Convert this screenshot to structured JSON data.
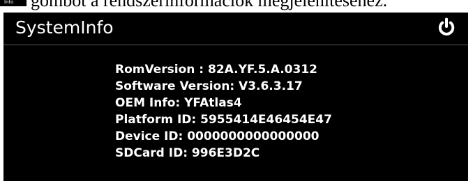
{
  "document_fragment": {
    "icon_label": "Info",
    "text": "gombot a rendszerinformációk megjelenítéséhez."
  },
  "window": {
    "title": "SystemInfo",
    "power_icon": "power-icon"
  },
  "system_info": {
    "rows": [
      "RomVersion : 82A.YF.5.A.0312",
      "Software Version: V3.6.3.17",
      "OEM Info: YFAtlas4",
      "Platform ID: 5955414E46454E47",
      "Device ID: 0000000000000000",
      "SDCard ID: 996E3D2C"
    ]
  },
  "colors": {
    "screen_background": "#000000",
    "text": "#ffffff",
    "divider": "#5a5a5a"
  }
}
